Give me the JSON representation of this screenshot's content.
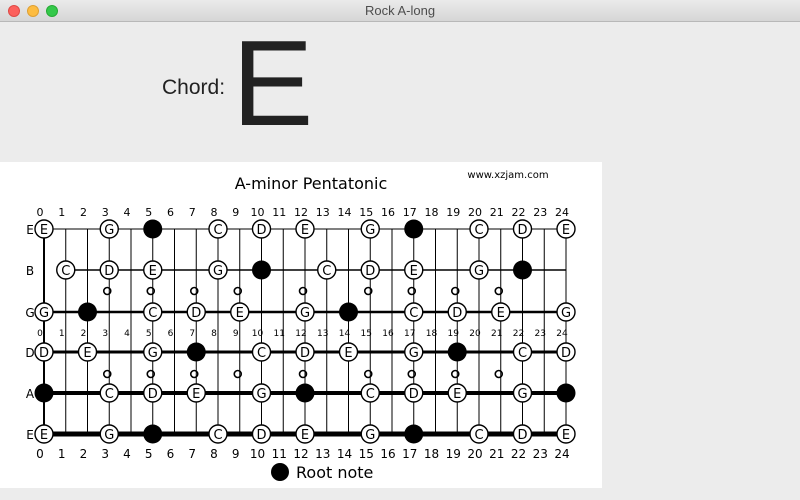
{
  "window": {
    "title": "Rock A-long"
  },
  "chord": {
    "label": "Chord:",
    "value": "E"
  },
  "scale_diagram": {
    "title": "A-minor Pentatonic",
    "source": "www.xzjam.com",
    "legend_label": "Root note",
    "fret_numbers": [
      "0",
      "1",
      "2",
      "3",
      "4",
      "5",
      "6",
      "7",
      "8",
      "9",
      "10",
      "11",
      "12",
      "13",
      "14",
      "15",
      "16",
      "17",
      "18",
      "19",
      "20",
      "21",
      "22",
      "23",
      "24"
    ],
    "strings": [
      {
        "name": "E",
        "notes": [
          {
            "fret": 0,
            "label": "E"
          },
          {
            "fret": 3,
            "label": "G"
          },
          {
            "fret": 5,
            "root": true
          },
          {
            "fret": 8,
            "label": "C"
          },
          {
            "fret": 10,
            "label": "D"
          },
          {
            "fret": 12,
            "label": "E"
          },
          {
            "fret": 15,
            "label": "G"
          },
          {
            "fret": 17,
            "root": true
          },
          {
            "fret": 20,
            "label": "C"
          },
          {
            "fret": 22,
            "label": "D"
          },
          {
            "fret": 24,
            "label": "E"
          }
        ]
      },
      {
        "name": "B",
        "notes": [
          {
            "fret": 1,
            "label": "C"
          },
          {
            "fret": 3,
            "label": "D"
          },
          {
            "fret": 5,
            "label": "E"
          },
          {
            "fret": 8,
            "label": "G"
          },
          {
            "fret": 10,
            "root": true
          },
          {
            "fret": 13,
            "label": "C"
          },
          {
            "fret": 15,
            "label": "D"
          },
          {
            "fret": 17,
            "label": "E"
          },
          {
            "fret": 20,
            "label": "G"
          },
          {
            "fret": 22,
            "root": true
          }
        ]
      },
      {
        "name": "G",
        "notes": [
          {
            "fret": 0,
            "label": "G"
          },
          {
            "fret": 2,
            "root": true
          },
          {
            "fret": 5,
            "label": "C"
          },
          {
            "fret": 7,
            "label": "D"
          },
          {
            "fret": 9,
            "label": "E"
          },
          {
            "fret": 12,
            "label": "G"
          },
          {
            "fret": 14,
            "root": true
          },
          {
            "fret": 17,
            "label": "C"
          },
          {
            "fret": 19,
            "label": "D"
          },
          {
            "fret": 21,
            "label": "E"
          },
          {
            "fret": 24,
            "label": "G"
          }
        ]
      },
      {
        "name": "D",
        "notes": [
          {
            "fret": 0,
            "label": "D"
          },
          {
            "fret": 2,
            "label": "E"
          },
          {
            "fret": 5,
            "label": "G"
          },
          {
            "fret": 7,
            "root": true
          },
          {
            "fret": 10,
            "label": "C"
          },
          {
            "fret": 12,
            "label": "D"
          },
          {
            "fret": 14,
            "label": "E"
          },
          {
            "fret": 17,
            "label": "G"
          },
          {
            "fret": 19,
            "root": true
          },
          {
            "fret": 22,
            "label": "C"
          },
          {
            "fret": 24,
            "label": "D"
          }
        ]
      },
      {
        "name": "A",
        "notes": [
          {
            "fret": 0,
            "root": true
          },
          {
            "fret": 3,
            "label": "C"
          },
          {
            "fret": 5,
            "label": "D"
          },
          {
            "fret": 7,
            "label": "E"
          },
          {
            "fret": 10,
            "label": "G"
          },
          {
            "fret": 12,
            "root": true
          },
          {
            "fret": 15,
            "label": "C"
          },
          {
            "fret": 17,
            "label": "D"
          },
          {
            "fret": 19,
            "label": "E"
          },
          {
            "fret": 22,
            "label": "G"
          },
          {
            "fret": 24,
            "root": true
          }
        ]
      },
      {
        "name": "E",
        "notes": [
          {
            "fret": 0,
            "label": "E"
          },
          {
            "fret": 3,
            "label": "G"
          },
          {
            "fret": 5,
            "root": true
          },
          {
            "fret": 8,
            "label": "C"
          },
          {
            "fret": 10,
            "label": "D"
          },
          {
            "fret": 12,
            "label": "E"
          },
          {
            "fret": 15,
            "label": "G"
          },
          {
            "fret": 17,
            "root": true
          },
          {
            "fret": 20,
            "label": "C"
          },
          {
            "fret": 22,
            "label": "D"
          },
          {
            "fret": 24,
            "label": "E"
          }
        ]
      }
    ],
    "single_dot_frets": [
      3,
      5,
      7,
      9,
      15,
      17,
      19,
      21
    ],
    "double_dot_frets": [
      12
    ]
  }
}
